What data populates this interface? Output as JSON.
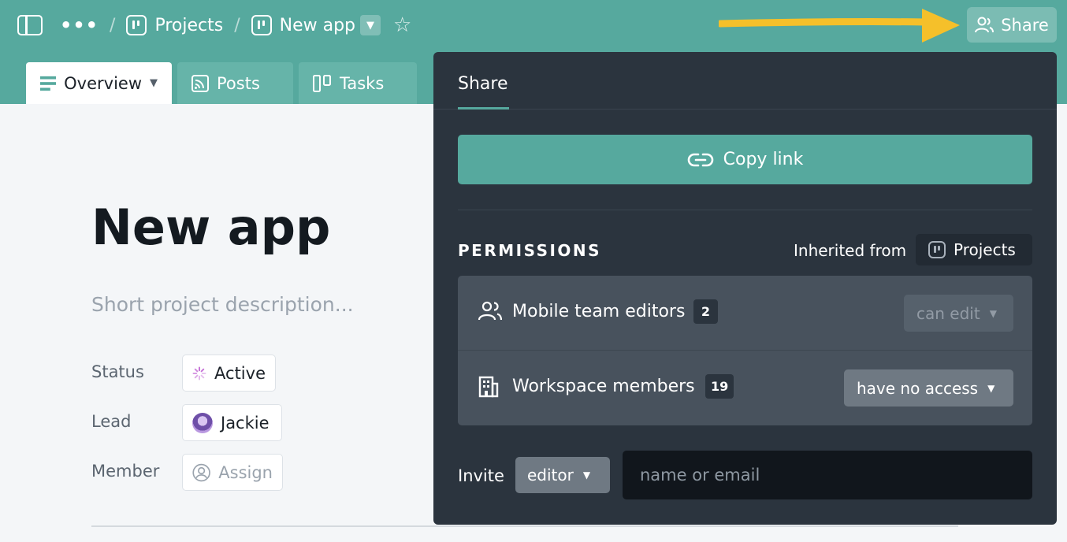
{
  "breadcrumb": {
    "more": "•••",
    "separator": "/",
    "items": [
      {
        "label": "Projects",
        "icon": "project-icon"
      },
      {
        "label": "New app",
        "icon": "project-icon"
      }
    ]
  },
  "header": {
    "share_label": "Share"
  },
  "tabs": [
    {
      "label": "Overview",
      "icon": "document-icon",
      "active": true
    },
    {
      "label": "Posts",
      "icon": "feed-icon",
      "active": false
    },
    {
      "label": "Tasks",
      "icon": "board-icon",
      "active": false
    }
  ],
  "main": {
    "title": "New app",
    "description_placeholder": "Short project description...",
    "properties": [
      {
        "label": "Status",
        "value": "Active",
        "icon": "spinner-icon"
      },
      {
        "label": "Lead",
        "value": "Jackie",
        "icon": "avatar"
      },
      {
        "label": "Member",
        "value": "Assign",
        "icon": "user-circle-icon"
      }
    ]
  },
  "share_panel": {
    "tab_label": "Share",
    "copy_link_label": "Copy link",
    "permissions_heading": "PERMISSIONS",
    "inherited_label": "Inherited from",
    "inherited_source": "Projects",
    "rows": [
      {
        "name": "Mobile team editors",
        "count": "2",
        "access": "can edit",
        "icon": "users-icon",
        "enabled": false
      },
      {
        "name": "Workspace members",
        "count": "19",
        "access": "have no access",
        "icon": "building-icon",
        "enabled": true
      }
    ],
    "invite_label": "Invite",
    "invite_role": "editor",
    "invite_placeholder": "name or email"
  },
  "colors": {
    "accent": "#56a99e",
    "panel_bg": "#2b343e",
    "annotation_arrow": "#f5c02a"
  }
}
